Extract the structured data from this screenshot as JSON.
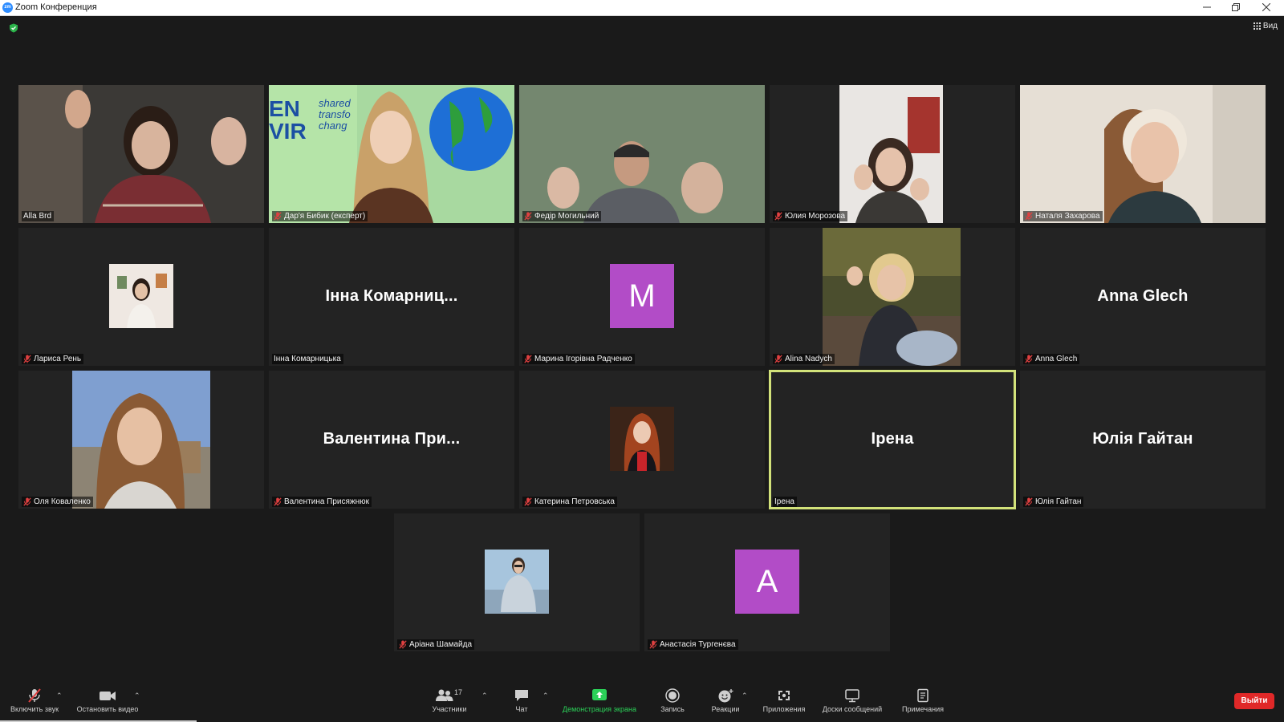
{
  "window": {
    "title": "Zoom Конференция",
    "app_icon_text": "zm"
  },
  "topbar": {
    "view_label": "Вид"
  },
  "colors": {
    "background": "#1a1a1a",
    "tile": "#232323",
    "active_speaker_border": "#d2e27a",
    "avatar_purple": "#b24cc7",
    "share_green": "#2bd158",
    "leave_red": "#e02828",
    "muted_red": "#e04040"
  },
  "participants": [
    {
      "name": "Alla Brd",
      "muted": false,
      "video": "camera"
    },
    {
      "name": "Дар'я Бибик (експерт)",
      "muted": true,
      "video": "camera"
    },
    {
      "name": "Федір Могильний",
      "muted": true,
      "video": "camera"
    },
    {
      "name": "Юлия Морозова",
      "muted": true,
      "video": "camera"
    },
    {
      "name": "Наталя Захарова",
      "muted": true,
      "video": "camera"
    },
    {
      "name": "Лариса Рень",
      "muted": true,
      "video": "photo"
    },
    {
      "name": "Інна Комарницька",
      "display_name": "Інна Комарниц...",
      "muted": false,
      "video": "name"
    },
    {
      "name": "Марина Ігорівна Радченко",
      "avatar_letter": "M",
      "muted": true,
      "video": "letter"
    },
    {
      "name": "Alina Nadych",
      "muted": true,
      "video": "camera"
    },
    {
      "name": "Anna Glech",
      "display_name": "Anna Glech",
      "muted": true,
      "video": "name"
    },
    {
      "name": "Оля Коваленко",
      "muted": true,
      "video": "camera"
    },
    {
      "name": "Валентина Присяжнюк",
      "display_name": "Валентина При...",
      "muted": true,
      "video": "name"
    },
    {
      "name": "Катерина Петровська",
      "muted": true,
      "video": "photo"
    },
    {
      "name": "Ірена",
      "display_name": "Ірена",
      "muted": false,
      "video": "name",
      "active_speaker": true
    },
    {
      "name": "Юлія Гайтан",
      "display_name": "Юлія Гайтан",
      "muted": true,
      "video": "name"
    },
    {
      "name": "Аріана Шамайда",
      "muted": true,
      "video": "photo"
    },
    {
      "name": "Анастасія Тургенєва",
      "avatar_letter": "A",
      "muted": true,
      "video": "letter"
    }
  ],
  "background_text": {
    "envir_logo": "EN VIR",
    "shared_line1": "shared",
    "shared_line2": "transfo",
    "shared_line3": "chang"
  },
  "toolbar": {
    "unmute_label": "Включить звук",
    "stop_video_label": "Остановить видео",
    "participants_label": "Участники",
    "participants_count": "17",
    "chat_label": "Чат",
    "share_label": "Демонстрация экрана",
    "record_label": "Запись",
    "reactions_label": "Реакции",
    "apps_label": "Приложения",
    "whiteboards_label": "Доски сообщений",
    "notes_label": "Примечания",
    "leave_label": "Выйти"
  }
}
